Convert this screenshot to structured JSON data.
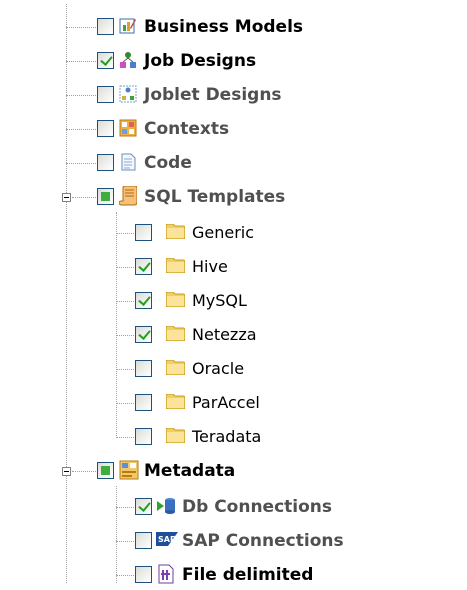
{
  "tree": {
    "items": [
      {
        "label": "Business Models",
        "icon": "business-model-icon",
        "checked": false,
        "partial": false
      },
      {
        "label": "Job Designs",
        "icon": "job-design-icon",
        "checked": true,
        "partial": false
      },
      {
        "label": "Joblet Designs",
        "icon": "joblet-design-icon",
        "checked": false,
        "partial": false
      },
      {
        "label": "Contexts",
        "icon": "contexts-icon",
        "checked": false,
        "partial": false
      },
      {
        "label": "Code",
        "icon": "code-icon",
        "checked": false,
        "partial": false
      },
      {
        "label": "SQL Templates",
        "icon": "sql-template-icon",
        "checked": false,
        "partial": true,
        "expanded": true,
        "children": [
          {
            "label": "Generic",
            "icon": "folder-icon",
            "checked": false
          },
          {
            "label": "Hive",
            "icon": "folder-icon",
            "checked": true
          },
          {
            "label": "MySQL",
            "icon": "folder-icon",
            "checked": true
          },
          {
            "label": "Netezza",
            "icon": "folder-icon",
            "checked": true
          },
          {
            "label": "Oracle",
            "icon": "folder-icon",
            "checked": false
          },
          {
            "label": "ParAccel",
            "icon": "folder-icon",
            "checked": false
          },
          {
            "label": "Teradata",
            "icon": "folder-icon",
            "checked": false
          }
        ]
      },
      {
        "label": "Metadata",
        "icon": "metadata-icon",
        "checked": false,
        "partial": true,
        "expanded": true,
        "children": [
          {
            "label": "Db Connections",
            "icon": "db-connection-icon",
            "checked": true
          },
          {
            "label": "SAP Connections",
            "icon": "sap-connection-icon",
            "checked": false
          },
          {
            "label": "File delimited",
            "icon": "file-delimited-icon",
            "checked": false
          }
        ]
      }
    ]
  },
  "colors": {
    "checkmark": "#21a121",
    "checkbox_border": "#1c5180",
    "folder": "#f3cf62",
    "tree_line": "#a0a0a0"
  }
}
